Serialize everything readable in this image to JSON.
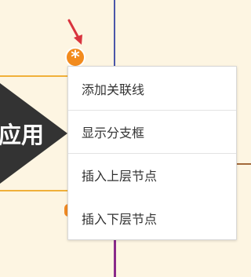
{
  "colors": {
    "canvas_bg": "#fdf5e2",
    "node_fill": "#333333",
    "node_border": "#f0b03a",
    "connector_top": "#4a56a8",
    "connector_bottom": "#8a2a8a",
    "connector_right": "#a2683a",
    "accent_orange": "#f28b1e",
    "arrow_red": "#d9343f"
  },
  "node": {
    "label": "应用"
  },
  "icons": {
    "badge": "asterisk-icon",
    "pointer": "red-arrow-icon"
  },
  "badge": {
    "symbol": "*"
  },
  "context_menu": {
    "items": [
      {
        "label": "添加关联线"
      },
      {
        "label": "显示分支框"
      },
      {
        "label": "插入上层节点"
      },
      {
        "label": "插入下层节点"
      }
    ]
  }
}
